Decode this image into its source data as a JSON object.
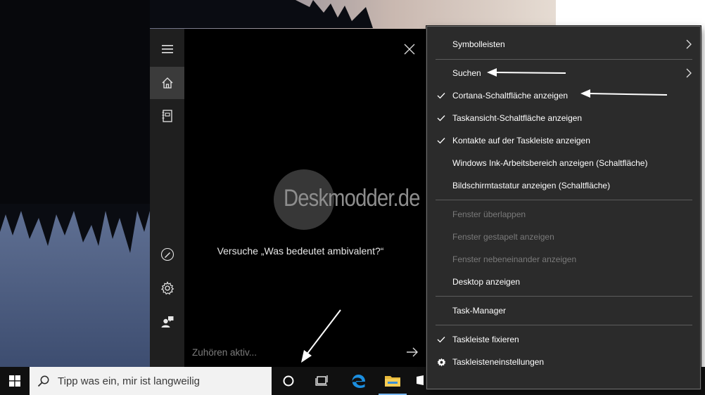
{
  "cortana": {
    "suggestion": "Versuche „Was bedeutet ambivalent?“",
    "input_placeholder": "Zuhören aktiv...",
    "watermark": "Deskmodder.de",
    "rail_items": [
      {
        "icon": "hamburger-menu-icon"
      },
      {
        "icon": "home-icon"
      },
      {
        "icon": "notebook-icon"
      },
      {
        "icon": "pen-icon"
      },
      {
        "icon": "settings-gear-icon"
      },
      {
        "icon": "feedback-person-icon"
      }
    ]
  },
  "taskbar": {
    "search_placeholder": "Tipp was ein, mir ist langweilig",
    "apps": [
      "cortana-circle-icon",
      "task-view-icon",
      "edge-icon",
      "file-explorer-icon"
    ]
  },
  "context_menu": {
    "items": [
      {
        "label": "Symbolleisten",
        "checked": false,
        "submenu": true,
        "enabled": true
      },
      {
        "label": "Suchen",
        "checked": false,
        "submenu": true,
        "enabled": true
      },
      {
        "label": "Cortana-Schaltfläche anzeigen",
        "checked": true,
        "submenu": false,
        "enabled": true
      },
      {
        "label": "Taskansicht-Schaltfläche anzeigen",
        "checked": true,
        "submenu": false,
        "enabled": true
      },
      {
        "label": "Kontakte auf der Taskleiste anzeigen",
        "checked": true,
        "submenu": false,
        "enabled": true
      },
      {
        "label": "Windows Ink-Arbeitsbereich anzeigen (Schaltfläche)",
        "checked": false,
        "submenu": false,
        "enabled": true
      },
      {
        "label": "Bildschirmtastatur anzeigen (Schaltfläche)",
        "checked": false,
        "submenu": false,
        "enabled": true
      },
      {
        "label": "Fenster überlappen",
        "checked": false,
        "submenu": false,
        "enabled": false
      },
      {
        "label": "Fenster gestapelt anzeigen",
        "checked": false,
        "submenu": false,
        "enabled": false
      },
      {
        "label": "Fenster nebeneinander anzeigen",
        "checked": false,
        "submenu": false,
        "enabled": false
      },
      {
        "label": "Desktop anzeigen",
        "checked": false,
        "submenu": false,
        "enabled": true
      },
      {
        "label": "Task-Manager",
        "checked": false,
        "submenu": false,
        "enabled": true
      },
      {
        "label": "Taskleiste fixieren",
        "checked": true,
        "submenu": false,
        "enabled": true
      },
      {
        "label": "Taskleisteneinstellungen",
        "checked": false,
        "submenu": false,
        "enabled": true,
        "icon": "gear-icon"
      }
    ]
  },
  "colors": {
    "menu_bg": "#2b2b2b",
    "menu_text": "#ffffff",
    "menu_disabled": "#7a7a7a",
    "taskbar_bg": "#101010",
    "cortana_bg": "#000000",
    "rail_bg": "#1f1f1f",
    "accent": "#0078d7"
  }
}
